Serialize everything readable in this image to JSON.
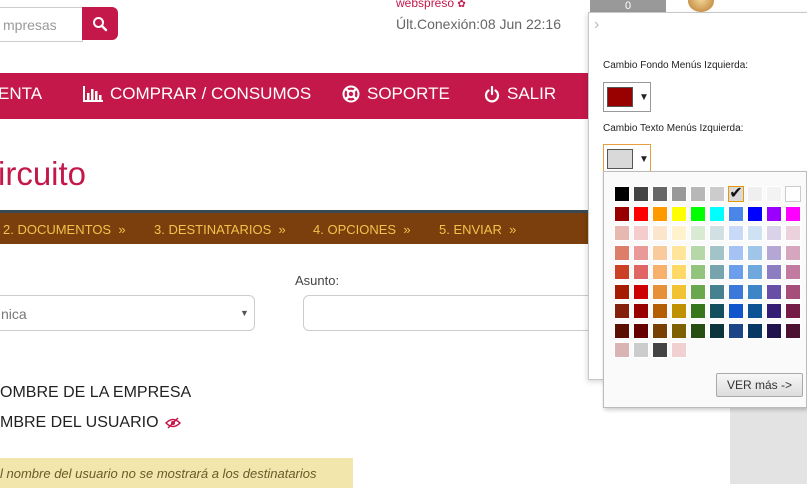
{
  "header": {
    "search_placeholder": "mpresas",
    "user_name": "webspreso",
    "last_connection": "Últ.Conexión:08 Jun 22:16",
    "badge_count": "0"
  },
  "nav": {
    "items": [
      "ENTA",
      "COMPRAR / CONSUMOS",
      "SOPORTE",
      "SALIR"
    ]
  },
  "page": {
    "title": "ircuito"
  },
  "steps": [
    "2. DOCUMENTOS",
    "3. DESTINATARIOS",
    "4. OPCIONES",
    "5. ENVIAR"
  ],
  "form": {
    "select_value": "nica",
    "asunto_label": "Asunto:",
    "company_option": "OMBRE DE LA EMPRESA",
    "user_option": "MBRE DEL USUARIO",
    "notice": "l nombre del usuario no se mostrará a los destinatarios"
  },
  "panel": {
    "bg_label": "Cambio Fondo Menús Izquierda:",
    "bg_color": "#990000",
    "text_label": "Cambio Texto Menús Izquierda:",
    "text_color": "#d9d9d9",
    "more_button": "VER más ->"
  },
  "palette": {
    "rows": [
      [
        "#000000",
        "#434343",
        "#666666",
        "#999999",
        "#b7b7b7",
        "#cccccc",
        "#d9d9d9",
        "#efefef",
        "#f3f3f3",
        "#ffffff"
      ],
      [
        "#980000",
        "#ff0000",
        "#ff9900",
        "#ffff00",
        "#00ff00",
        "#00ffff",
        "#4a86e8",
        "#0000ff",
        "#9900ff",
        "#ff00ff"
      ],
      [
        "#e6b8af",
        "#f4cccc",
        "#fce5cd",
        "#fff2cc",
        "#d9ead3",
        "#d0e0e3",
        "#c9daf8",
        "#cfe2f3",
        "#d9d2e9",
        "#ead1dc"
      ],
      [
        "#dd7e6b",
        "#ea9999",
        "#f9cb9c",
        "#ffe599",
        "#b6d7a8",
        "#a2c4c9",
        "#a4c2f4",
        "#9fc5e8",
        "#b4a7d6",
        "#d5a6bd"
      ],
      [
        "#cc4125",
        "#e06666",
        "#f6b26b",
        "#ffd966",
        "#93c47d",
        "#76a5af",
        "#6d9eeb",
        "#6fa8dc",
        "#8e7cc3",
        "#c27ba0"
      ],
      [
        "#a61c00",
        "#cc0000",
        "#e69138",
        "#f1c232",
        "#6aa84f",
        "#45818e",
        "#3c78d8",
        "#3d85c6",
        "#674ea7",
        "#a64d79"
      ],
      [
        "#85200c",
        "#990000",
        "#b45f06",
        "#bf9000",
        "#38761d",
        "#134f5c",
        "#1155cc",
        "#0b5394",
        "#351c75",
        "#741b47"
      ],
      [
        "#5b0f00",
        "#660000",
        "#783f04",
        "#7f6000",
        "#274e13",
        "#0c343d",
        "#1c4587",
        "#073763",
        "#20124d",
        "#4c1130"
      ],
      [
        "#d8b4b4",
        "#cccccc",
        "#444444",
        "#f0d0d0"
      ]
    ],
    "selected": "#d9d9d9"
  }
}
